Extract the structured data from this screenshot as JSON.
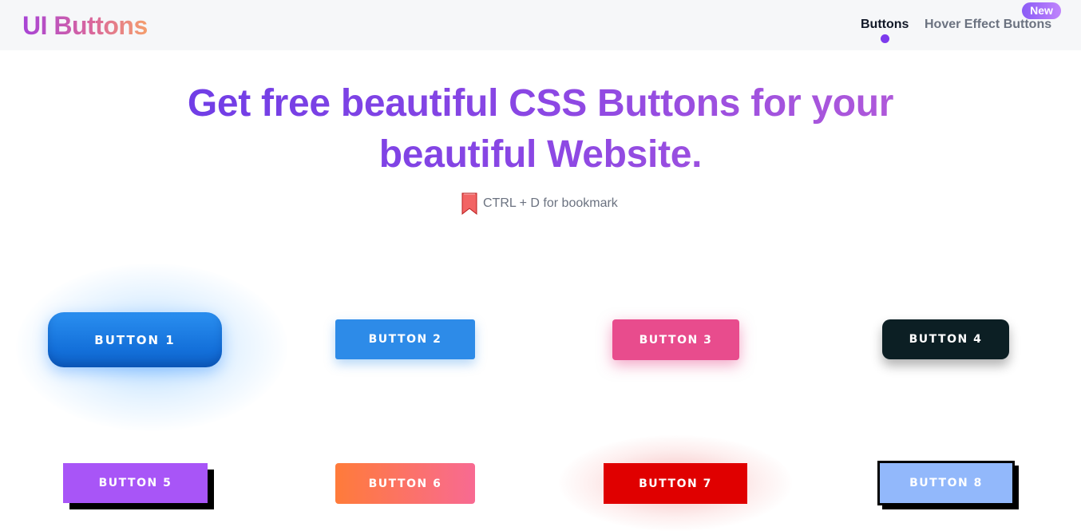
{
  "header": {
    "logo": "UI Buttons",
    "nav": [
      {
        "label": "Buttons",
        "active": true
      },
      {
        "label": "Hover Effect Buttons",
        "badge": "New"
      }
    ]
  },
  "hero": {
    "headline": "Get free beautiful CSS Buttons for your beautiful Website.",
    "bookmark_hint": "CTRL + D for bookmark",
    "bookmark_icon": "bookmark-icon"
  },
  "buttons": [
    {
      "label": "BUTTON 1",
      "color": "#1b7de6"
    },
    {
      "label": "BUTTON 2",
      "color": "#2d8be8"
    },
    {
      "label": "BUTTON 3",
      "color": "#e84c8d"
    },
    {
      "label": "BUTTON 4",
      "color": "#0c1f24"
    },
    {
      "label": "BUTTON 5",
      "color": "#a855f7"
    },
    {
      "label": "BUTTON 6",
      "color": "#ff7b3a"
    },
    {
      "label": "BUTTON 7",
      "color": "#e00000"
    },
    {
      "label": "BUTTON 8",
      "color": "#92b8fb"
    }
  ],
  "colors": {
    "accent": "#7c3aed",
    "topbar_bg": "#f6f7f9",
    "muted_text": "#6b7280"
  }
}
